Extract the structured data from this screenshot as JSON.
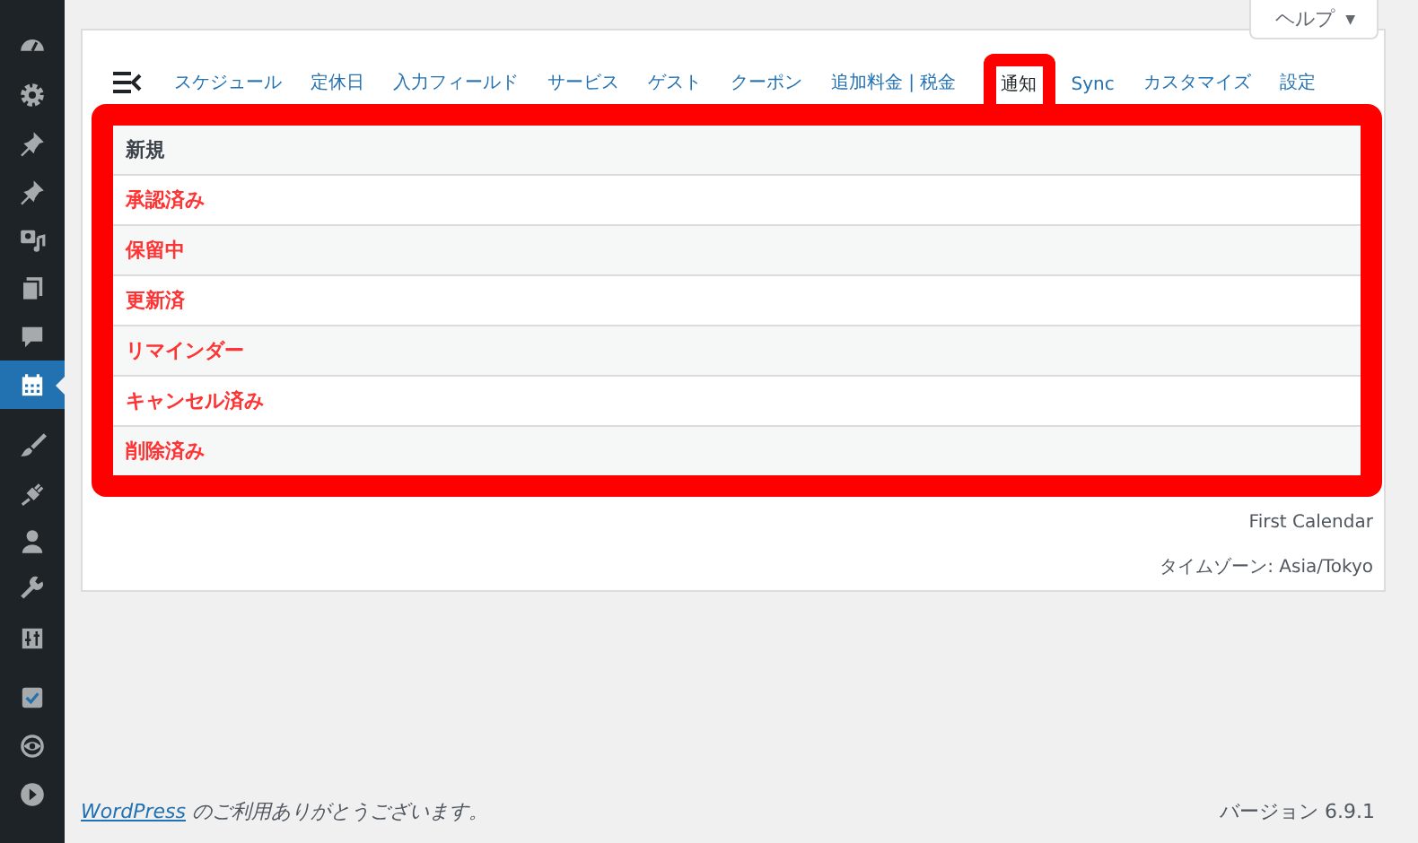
{
  "help_tab": {
    "label": "ヘルプ",
    "caret": "▼"
  },
  "sidebar": {
    "items": [
      {
        "selected": false
      },
      {
        "selected": false
      },
      {
        "selected": false
      },
      {
        "selected": false
      },
      {
        "selected": false
      },
      {
        "selected": false
      },
      {
        "selected": false
      },
      {
        "selected": true
      },
      {
        "selected": false
      },
      {
        "selected": false
      },
      {
        "selected": false
      },
      {
        "selected": false
      },
      {
        "selected": false
      },
      {
        "selected": false
      },
      {
        "selected": false
      },
      {
        "selected": false
      }
    ]
  },
  "tabs": [
    {
      "label": "スケジュール",
      "selected": false,
      "highlighted": false
    },
    {
      "label": "定休日",
      "selected": false,
      "highlighted": false
    },
    {
      "label": "入力フィールド",
      "selected": false,
      "highlighted": false
    },
    {
      "label": "サービス",
      "selected": false,
      "highlighted": false
    },
    {
      "label": "ゲスト",
      "selected": false,
      "highlighted": false
    },
    {
      "label": "クーポン",
      "selected": false,
      "highlighted": false
    },
    {
      "label": "追加料金 | 税金",
      "selected": false,
      "highlighted": false
    },
    {
      "label": "通知",
      "selected": true,
      "highlighted": true
    },
    {
      "label": "Sync",
      "selected": false,
      "highlighted": false
    },
    {
      "label": "カスタマイズ",
      "selected": false,
      "highlighted": false
    },
    {
      "label": "設定",
      "selected": false,
      "highlighted": false
    }
  ],
  "notifications": {
    "highlighted": true,
    "items": [
      {
        "label": "新規",
        "color": "#3c434a"
      },
      {
        "label": "承認済み",
        "color": "#ff3333"
      },
      {
        "label": "保留中",
        "color": "#ff3333"
      },
      {
        "label": "更新済",
        "color": "#ff3333"
      },
      {
        "label": "リマインダー",
        "color": "#ff3333"
      },
      {
        "label": "キャンセル済み",
        "color": "#ff3333"
      },
      {
        "label": "削除済み",
        "color": "#ff3333"
      }
    ]
  },
  "calendar_name": "First Calendar",
  "timezone": "タイムゾーン: Asia/Tokyo",
  "footer": {
    "link": "WordPress",
    "thanks": "のご利用ありがとうございます。",
    "version": "バージョン 6.9.1"
  }
}
